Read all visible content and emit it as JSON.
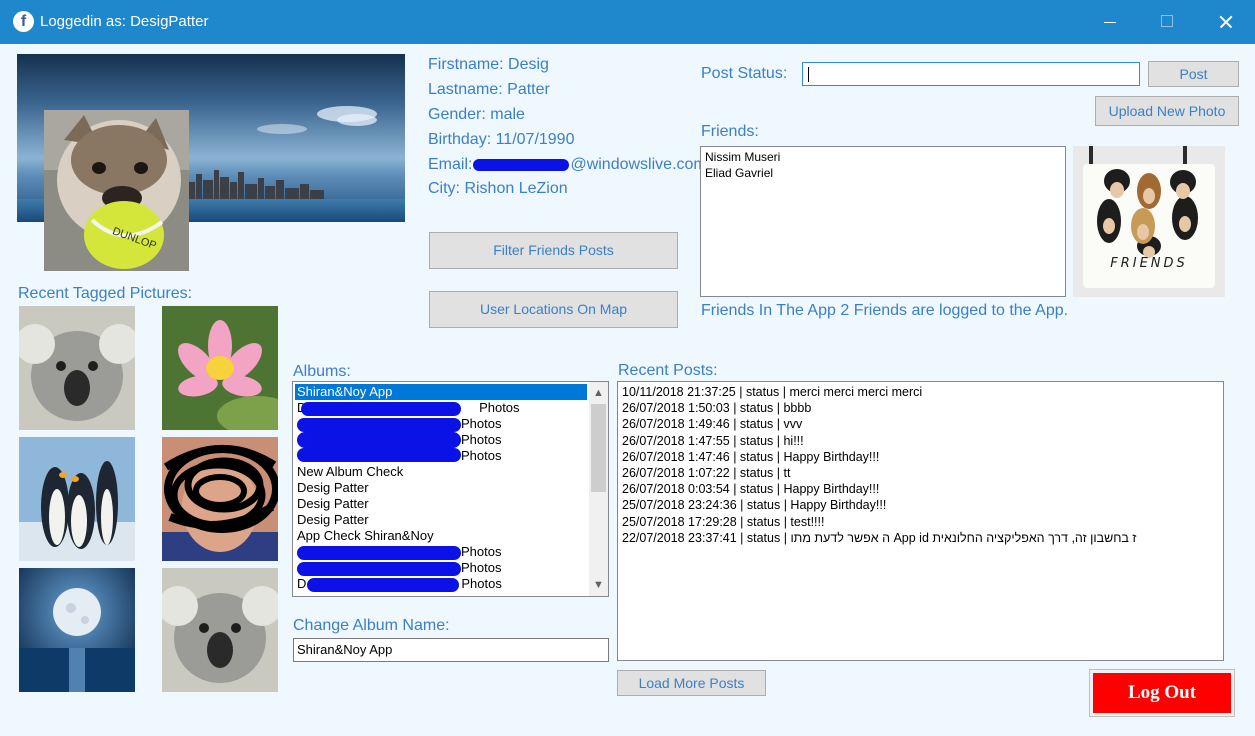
{
  "window": {
    "title": "Loggedin as: DesigPatter",
    "app_icon": "facebook-icon",
    "controls": [
      "minimize-icon",
      "maximize-icon",
      "close-icon"
    ]
  },
  "profile": {
    "firstname": "Firstname: Desig",
    "lastname": "Lastname: Patter",
    "gender": "Gender: male",
    "birthday": "Birthday: 11/07/1990",
    "email_prefix": "Email:",
    "email_suffix": "@windowslive.com",
    "city": "City: Rishon LeZion"
  },
  "buttons": {
    "filter_friends_posts": "Filter Friends Posts",
    "user_locations": "User Locations On Map",
    "post": "Post",
    "upload_photo": "Upload New Photo",
    "load_more_posts": "Load More Posts",
    "log_out": "Log Out"
  },
  "post_status": {
    "label": "Post Status:",
    "value": ""
  },
  "friends": {
    "label": "Friends:",
    "items": [
      "Nissim Museri",
      "Eliad Gavriel"
    ],
    "picture_caption": "FRIENDS",
    "summary": "Friends In The App 2 Friends are logged to the App."
  },
  "tagged_pictures": {
    "label": "Recent Tagged Pictures:"
  },
  "albums": {
    "label": "Albums:",
    "items": [
      "Shiran&Noy App",
      "Photos",
      "Photos",
      "Photos",
      "Photos",
      "New Album Check",
      "Desig Patter",
      "Desig Patter",
      "Desig Patter",
      "App Check Shiran&Noy",
      "Photos",
      "Photos",
      "Photos"
    ],
    "item_prefixes": [
      "",
      "DP",
      "",
      "",
      "",
      "",
      "",
      "",
      "",
      "",
      "",
      "",
      "D"
    ],
    "selected_index": 0
  },
  "change_album_name": {
    "label": "Change Album Name:",
    "value": "Shiran&Noy App"
  },
  "recent_posts": {
    "label": "Recent Posts:",
    "items": [
      "10/11/2018 21:37:25 | status | merci merci merci merci",
      "26/07/2018 1:50:03 | status | bbbb",
      "26/07/2018 1:49:46 | status | vvv",
      "26/07/2018 1:47:55 | status | hi!!!",
      "26/07/2018 1:47:46 | status | Happy Birthday!!!",
      "26/07/2018 1:07:22 | status | tt",
      "26/07/2018 0:03:54 | status | Happy Birthday!!!",
      "25/07/2018 23:24:36 | status | Happy Birthday!!!",
      "25/07/2018 17:29:28 | status | test!!!!",
      "22/07/2018 23:37:41 | status | ה אפשר לדעת מתו App id ז בחשבון זה, דרך האפליקציה החלונאית"
    ]
  },
  "colors": {
    "titlebar": "#1f88cc",
    "label_text": "#3a7fc8",
    "background": "#f0f8ff",
    "logout": "#ff0000",
    "selection": "#0078d7",
    "redaction": "#0a12e6"
  }
}
